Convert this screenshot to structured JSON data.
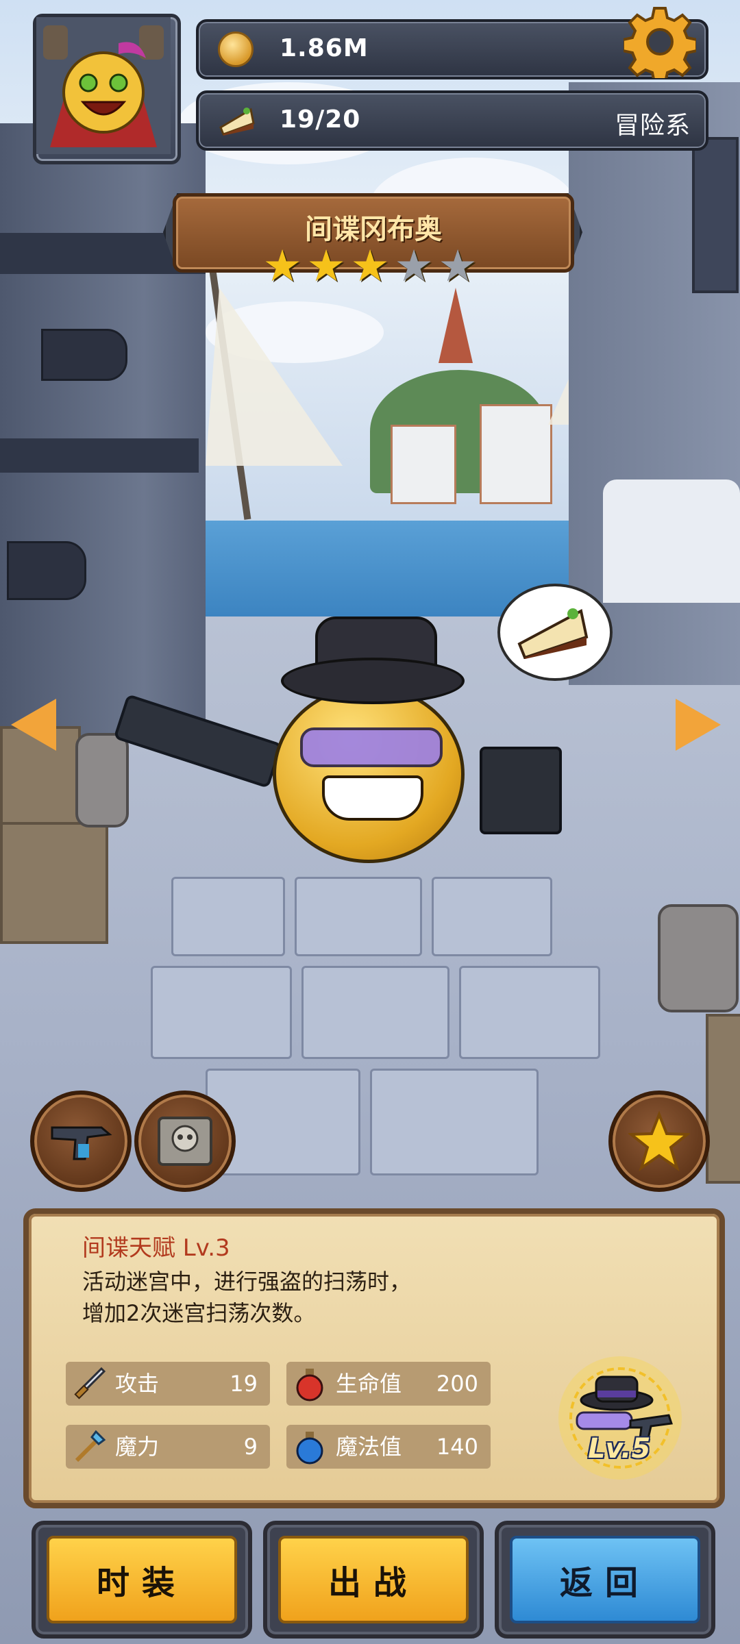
{
  "hud": {
    "gold": "1.86M",
    "stamina": "19/20",
    "faction": "冒险系",
    "settings_icon": "gear-icon",
    "coin_icon": "coin-icon",
    "cake_icon": "cake-slice-icon"
  },
  "hero": {
    "name": "间谍冈布奥",
    "stars_total": 5,
    "stars_filled": 3,
    "star_char": "★"
  },
  "talent": {
    "title": "间谍天赋 Lv.3",
    "desc_line1": "活动迷宫中，进行强盗的扫荡时，",
    "desc_line2": "增加2次迷宫扫荡次数。"
  },
  "stats": [
    {
      "label": "攻击",
      "value": "19",
      "icon": "sword-icon"
    },
    {
      "label": "生命值",
      "value": "200",
      "icon": "red-potion-icon"
    },
    {
      "label": "魔力",
      "value": "9",
      "icon": "magic-staff-icon"
    },
    {
      "label": "魔法值",
      "value": "140",
      "icon": "blue-potion-icon"
    }
  ],
  "equipment": {
    "level": "Lv.5"
  },
  "buttons": {
    "costume": "时装",
    "deploy": "出战",
    "back": "返回"
  },
  "colors": {
    "gold_button": "#f0a21c",
    "blue_button": "#2e8ad4",
    "star_filled": "#f6c21a",
    "star_empty": "#9aa0aa",
    "talent_title": "#b23a1e"
  }
}
